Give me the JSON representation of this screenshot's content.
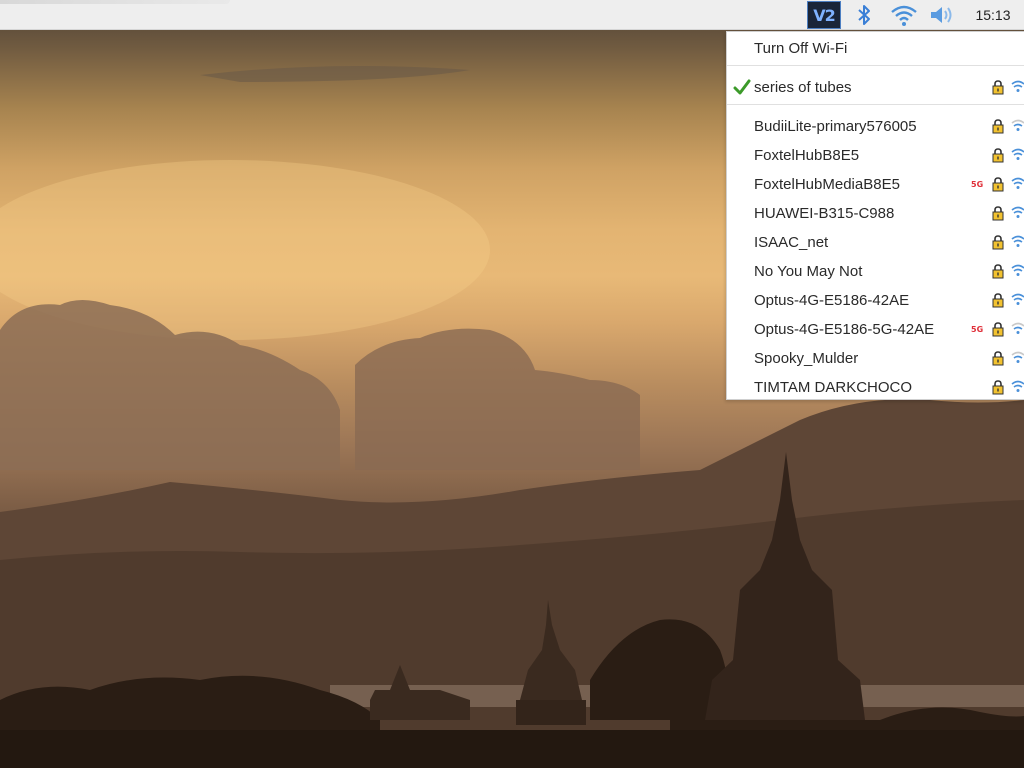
{
  "taskbar": {
    "vnc_label": "V2",
    "clock": "15:13",
    "icons": [
      "vnc-icon",
      "bluetooth-icon",
      "wifi-icon",
      "volume-icon"
    ]
  },
  "wifi_menu": {
    "toggle_label": "Turn Off Wi-Fi",
    "connected": {
      "ssid": "series of tubes",
      "secured": true,
      "signal": "full"
    },
    "networks": [
      {
        "ssid": "BudiiLite-primary576005",
        "band": "",
        "secured": true,
        "signal": "weak"
      },
      {
        "ssid": "FoxtelHubB8E5",
        "band": "",
        "secured": true,
        "signal": "good"
      },
      {
        "ssid": "FoxtelHubMediaB8E5",
        "band": "5G",
        "secured": true,
        "signal": "good"
      },
      {
        "ssid": "HUAWEI-B315-C988",
        "band": "",
        "secured": true,
        "signal": "good"
      },
      {
        "ssid": "ISAAC_net",
        "band": "",
        "secured": true,
        "signal": "good"
      },
      {
        "ssid": "No You May Not",
        "band": "",
        "secured": true,
        "signal": "good"
      },
      {
        "ssid": "Optus-4G-E5186-42AE",
        "band": "",
        "secured": true,
        "signal": "good"
      },
      {
        "ssid": "Optus-4G-E5186-5G-42AE",
        "band": "5G",
        "secured": true,
        "signal": "weak"
      },
      {
        "ssid": "Spooky_Mulder",
        "band": "",
        "secured": true,
        "signal": "weak"
      },
      {
        "ssid": "TIMTAM DARKCHOCO",
        "band": "",
        "secured": true,
        "signal": "good"
      }
    ]
  },
  "colors": {
    "accent_blue": "#4a90d9",
    "check_green": "#3c9a2a",
    "band_red": "#e0303a",
    "lock_yellow": "#f2c230"
  }
}
